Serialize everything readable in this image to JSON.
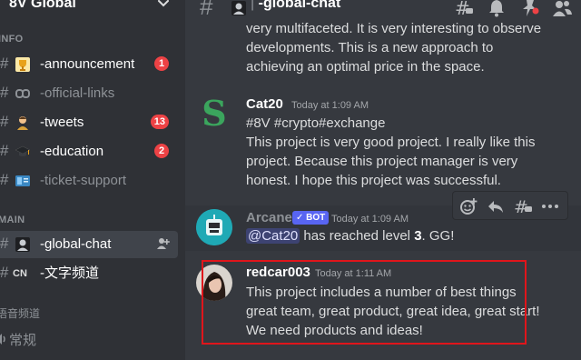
{
  "server": {
    "name": "8V Global"
  },
  "sidebar": {
    "category_info": "INFO",
    "category_main": "MAIN",
    "category_voice": "语音频道",
    "channels": [
      {
        "name": "-announcement",
        "emoji": "trophy-icon",
        "badge": "1",
        "muted": false
      },
      {
        "name": "-official-links",
        "emoji": "link-icon",
        "muted": true
      },
      {
        "name": "-tweets",
        "emoji": "man-icon",
        "badge": "13",
        "muted": false
      },
      {
        "name": "-education",
        "emoji": "grad-cap-icon",
        "badge": "2",
        "muted": false
      },
      {
        "name": "-ticket-support",
        "emoji": "ticket-icon",
        "muted": true
      },
      {
        "name": "-global-chat",
        "emoji": "globe-icon",
        "muted": false,
        "active": true
      },
      {
        "name": "-文字频道",
        "tag": "CN",
        "muted": false
      }
    ],
    "voice_channel": "常规"
  },
  "header": {
    "channel_name": "-global-chat",
    "separator": "|"
  },
  "messages": {
    "prev": {
      "lines": [
        "very multifaceted. It is very interesting to observe",
        "developments. This is a new approach to",
        "achieving an optimal price in the space."
      ]
    },
    "cat20": {
      "author": "Cat20",
      "timestamp": "Today at 1:09 AM",
      "avatar_letter": "S",
      "lines": [
        "#8V #crypto#exchange",
        "This project is very good project. I really like this",
        "project. Because this project manager is very",
        "honest. I hope this project was successful."
      ]
    },
    "arcane": {
      "author": "Arcane",
      "bot_label": "✓ BOT",
      "timestamp": "Today at 1:09 AM",
      "mention": "@Cat20",
      "text_before": " has reached level ",
      "level": "3",
      "text_after": ". GG!"
    },
    "redcar": {
      "author": "redcar003",
      "timestamp": "Today at 1:11 AM",
      "lines": [
        "This project includes a number of best things",
        "great team, great product, great idea, great start!",
        "We need products and ideas!"
      ]
    }
  },
  "colors": {
    "accent": "#5865f2",
    "badge_red": "#ed4245",
    "highlight_red": "#e0151b",
    "cat20_green": "#3ba55d",
    "arcane_teal": "#1fa9b5"
  }
}
